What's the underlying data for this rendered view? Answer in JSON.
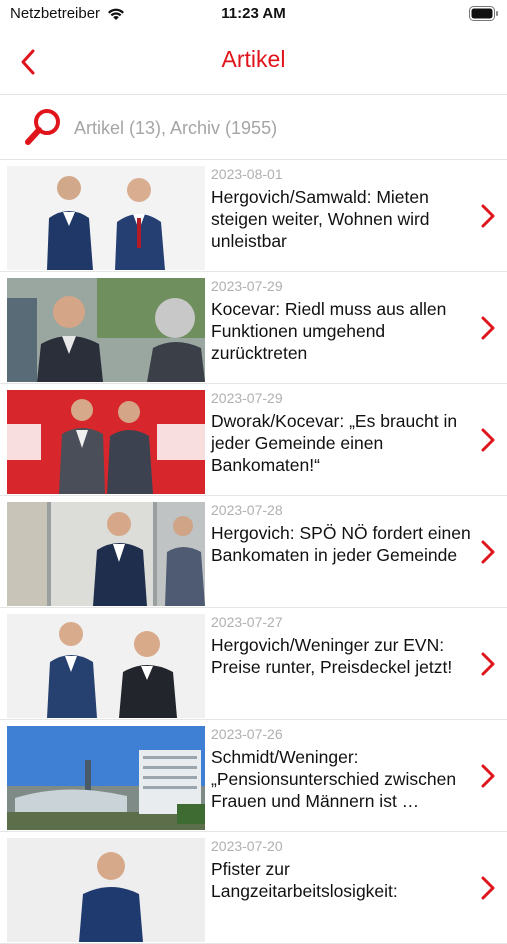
{
  "status_bar": {
    "carrier": "Netzbetreiber",
    "time": "11:23 AM"
  },
  "nav": {
    "title": "Artikel"
  },
  "search": {
    "placeholder": "Artikel (13), Archiv (1955)",
    "value": ""
  },
  "colors": {
    "accent": "#e0151b",
    "date_text": "#b0b0b0",
    "divider": "#e6e6e6"
  },
  "articles": [
    {
      "date": "2023-08-01",
      "title": "Hergovich/Samwald: Mieten steigen weiter, Wohnen wird unleistbar"
    },
    {
      "date": "2023-07-29",
      "title": "Kocevar: Riedl muss aus allen Funktionen umgehend zurücktreten"
    },
    {
      "date": "2023-07-29",
      "title": "Dworak/Kocevar: „Es braucht in jeder Gemeinde einen Bankomaten!“"
    },
    {
      "date": "2023-07-28",
      "title": "Hergovich: SPÖ NÖ fordert einen Bankomaten in jeder Gemeinde"
    },
    {
      "date": "2023-07-27",
      "title": "Hergovich/Weninger zur EVN: Preise runter, Preisdeckel jetzt!"
    },
    {
      "date": "2023-07-26",
      "title": "Schmidt/Weninger: „Pensionsunterschied zwischen Frauen und Männern ist …"
    },
    {
      "date": "2023-07-20",
      "title": "Pfister zur Langzeitarbeitslosigkeit:"
    }
  ]
}
